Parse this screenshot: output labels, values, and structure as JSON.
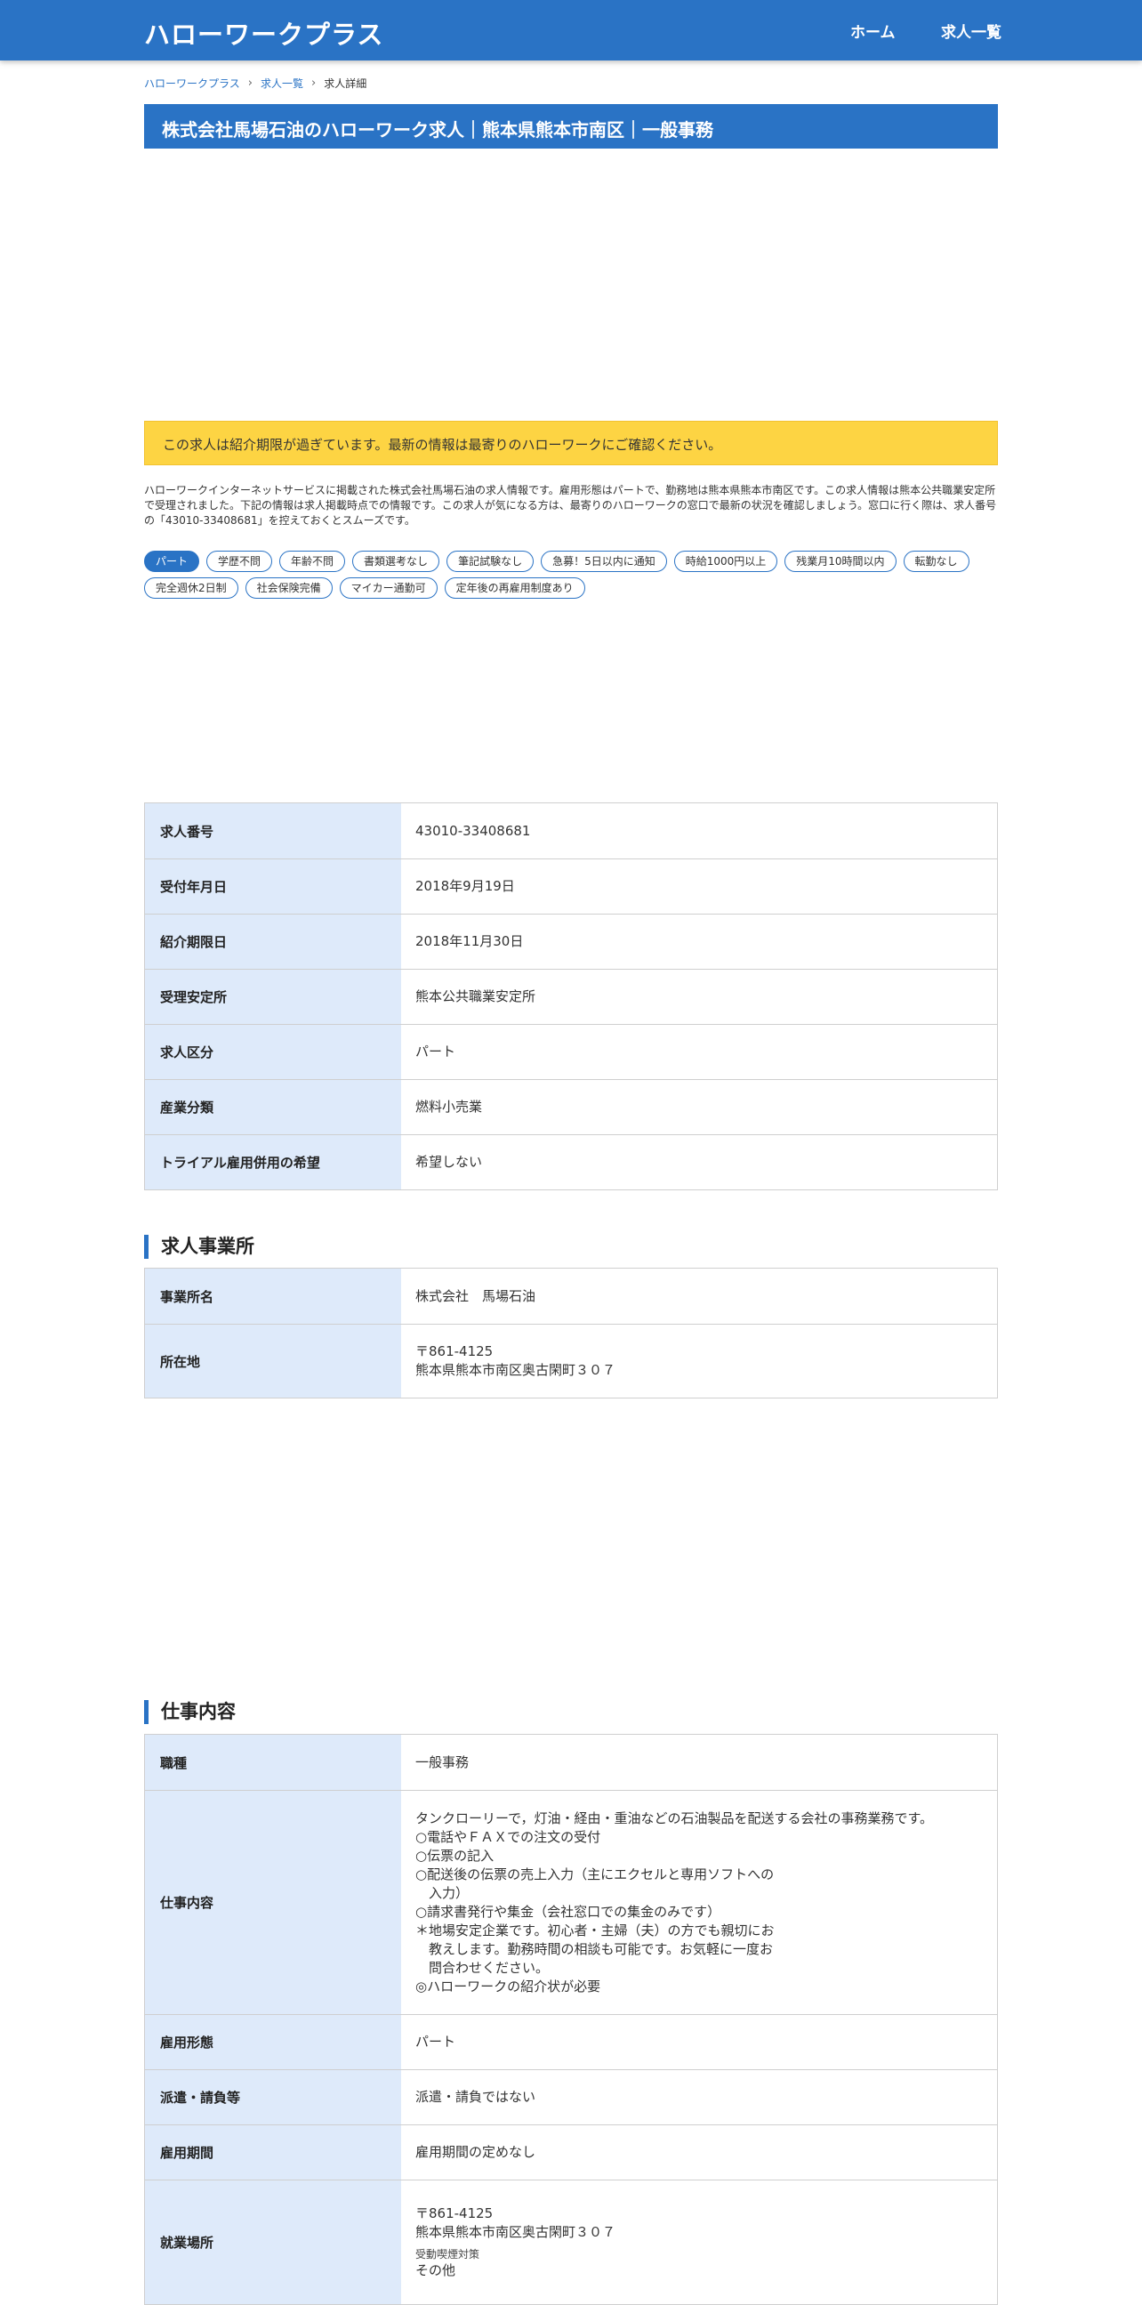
{
  "header": {
    "site_title": "ハローワークプラス",
    "nav": {
      "home": "ホーム",
      "jobs": "求人一覧"
    }
  },
  "breadcrumb": {
    "item1": "ハローワークプラス",
    "item2": "求人一覧",
    "current": "求人詳細"
  },
  "page_title": "株式会社馬場石油のハローワーク求人｜熊本県熊本市南区｜一般事務",
  "notice": "この求人は紹介期限が過ぎています。最新の情報は最寄りのハローワークにご確認ください。",
  "intro": "ハローワークインターネットサービスに掲載された株式会社馬場石油の求人情報です。雇用形態はパートで、勤務地は熊本県熊本市南区です。この求人情報は熊本公共職業安定所で受理されました。下記の情報は求人掲載時点での情報です。この求人が気になる方は、最寄りのハローワークの窓口で最新の状況を確認しましょう。窓口に行く際は、求人番号の「43010-33408681」を控えておくとスムーズです。",
  "tags": [
    "パート",
    "学歴不問",
    "年齢不問",
    "書類選考なし",
    "筆記試験なし",
    "急募！5日以内に通知",
    "時給1000円以上",
    "残業月10時間以内",
    "転勤なし",
    "完全週休2日制",
    "社会保険完備",
    "マイカー通勤可",
    "定年後の再雇用制度あり"
  ],
  "basic": [
    {
      "label": "求人番号",
      "value": "43010-33408681"
    },
    {
      "label": "受付年月日",
      "value": "2018年9月19日"
    },
    {
      "label": "紹介期限日",
      "value": "2018年11月30日"
    },
    {
      "label": "受理安定所",
      "value": "熊本公共職業安定所"
    },
    {
      "label": "求人区分",
      "value": "パート"
    },
    {
      "label": "産業分類",
      "value": "燃料小売業"
    },
    {
      "label": "トライアル雇用併用の希望",
      "value": "希望しない"
    }
  ],
  "office": {
    "title": "求人事業所",
    "name_label": "事業所名",
    "name_value": "株式会社　馬場石油",
    "address_label": "所在地",
    "postal": "〒861-4125",
    "address": "熊本県熊本市南区奥古閑町３０７"
  },
  "work": {
    "title": "仕事内容",
    "occupation_label": "職種",
    "occupation_value": "一般事務",
    "content_label": "仕事内容",
    "content_value": "タンクローリーで，灯油・経由・重油などの石油製品を配送する会社の事務業務です。\n○電話やＦＡＸでの注文の受付\n○伝票の記入\n○配送後の伝票の売上入力（主にエクセルと専用ソフトへの\n　入力）\n○請求書発行や集金（会社窓口での集金のみです）\n＊地場安定企業です。初心者・主婦（夫）の方でも親切にお\n　教えします。勤務時間の相談も可能です。お気軽に一度お\n　問合わせください。\n◎ハローワークの紹介状が必要",
    "employment_label": "雇用形態",
    "employment_value": "パート",
    "dispatch_label": "派遣・請負等",
    "dispatch_value": "派遣・請負ではない",
    "period_label": "雇用期間",
    "period_value": "雇用期間の定めなし",
    "place_label": "就業場所",
    "place_postal": "〒861-4125",
    "place_address": "熊本県熊本市南区奥古閑町３０７",
    "smoking_label": "受動喫煙対策",
    "smoking_value": "その他"
  }
}
